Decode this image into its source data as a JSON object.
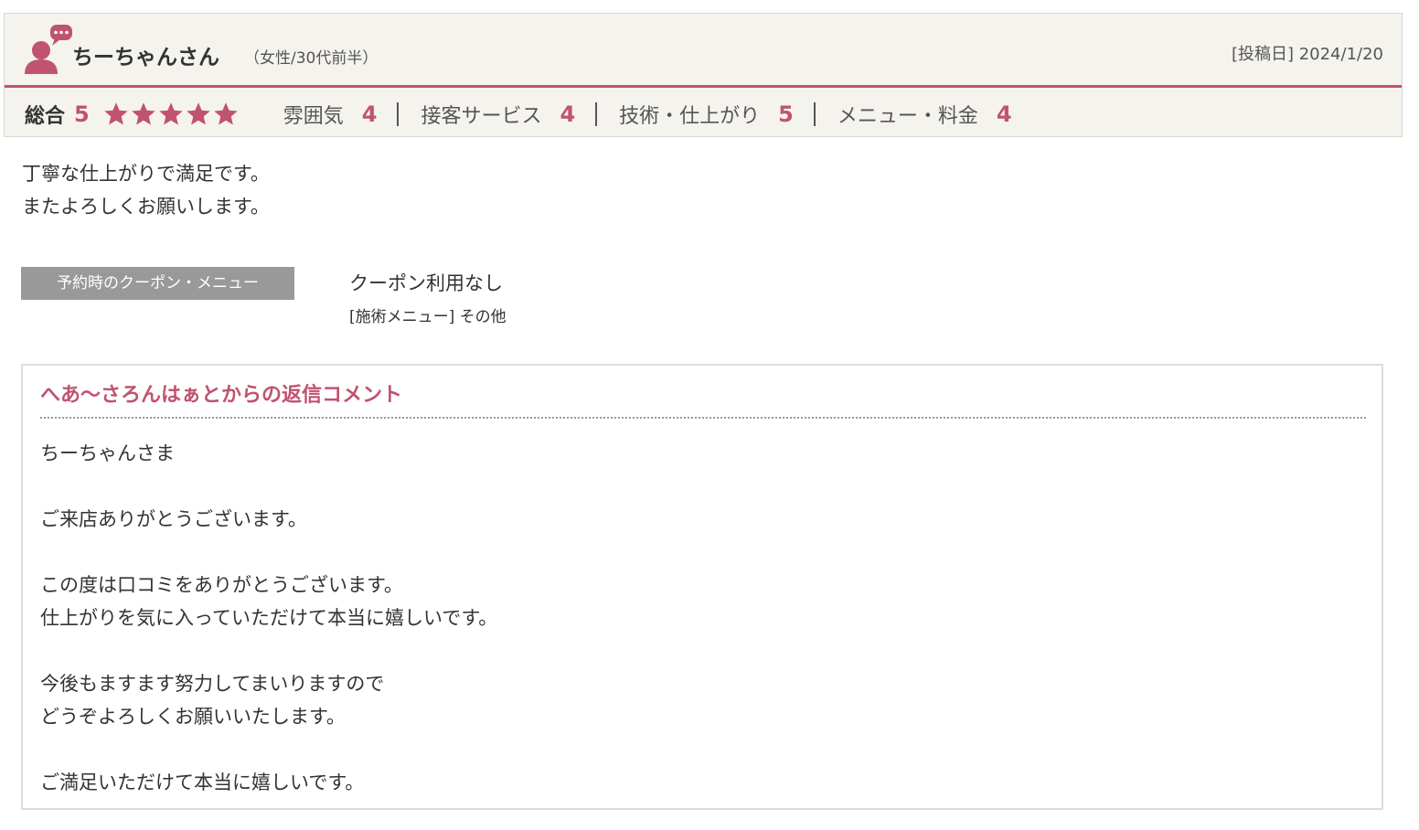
{
  "colors": {
    "accent": "#c0536f",
    "header_bg": "#f5f3ee",
    "tag_bg": "#999999"
  },
  "reviewer": {
    "avatar_icon": "user-comment-icon",
    "name": "ちーちゃんさん",
    "meta": "（女性/30代前半）",
    "post_date": "[投稿日] 2024/1/20"
  },
  "ratings": {
    "overall_label": "総合",
    "overall_score": "5",
    "stars_filled": 5,
    "stars_total": 5,
    "star_icon": "star-icon",
    "categories": [
      {
        "label": "雰囲気",
        "score": "4"
      },
      {
        "label": "接客サービス",
        "score": "4"
      },
      {
        "label": "技術・仕上がり",
        "score": "5"
      },
      {
        "label": "メニュー・料金",
        "score": "4"
      }
    ]
  },
  "review": {
    "lines": [
      "丁寧な仕上がりで満足です。",
      "またよろしくお願いします。"
    ]
  },
  "coupon": {
    "tag_label": "予約時のクーポン・メニュー",
    "value": "クーポン利用なし",
    "menu": "[施術メニュー] その他"
  },
  "reply": {
    "title": "へあ〜さろんはぁとからの返信コメント",
    "lines": [
      "ちーちゃんさま",
      "",
      "ご来店ありがとうございます。",
      "",
      "この度は口コミをありがとうございます。",
      "仕上がりを気に入っていただけて本当に嬉しいです。",
      "",
      "今後もますます努力してまいりますので",
      "どうぞよろしくお願いいたします。",
      "",
      "ご満足いただけて本当に嬉しいです。"
    ]
  }
}
